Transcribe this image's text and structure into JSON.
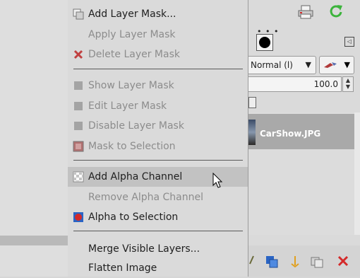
{
  "menu": {
    "items": [
      {
        "label": "Add Layer Mask...",
        "enabled": true,
        "icon": "add-mask-icon"
      },
      {
        "label": "Apply Layer Mask",
        "enabled": false,
        "icon": ""
      },
      {
        "label": "Delete Layer Mask",
        "enabled": false,
        "icon": "delete-icon"
      },
      {
        "label": "Show Layer Mask",
        "enabled": false,
        "icon": "checkbox-icon"
      },
      {
        "label": "Edit Layer Mask",
        "enabled": false,
        "icon": "checkbox-icon"
      },
      {
        "label": "Disable Layer Mask",
        "enabled": false,
        "icon": "checkbox-icon"
      },
      {
        "label": "Mask to Selection",
        "enabled": false,
        "icon": "mask-selection-icon"
      },
      {
        "label": "Add Alpha Channel",
        "enabled": true,
        "highlighted": true,
        "icon": "alpha-channel-icon"
      },
      {
        "label": "Remove Alpha Channel",
        "enabled": false,
        "icon": ""
      },
      {
        "label": "Alpha to Selection",
        "enabled": true,
        "icon": "alpha-selection-icon"
      },
      {
        "label": "Merge Visible Layers...",
        "enabled": true,
        "icon": ""
      },
      {
        "label": "Flatten Image",
        "enabled": true,
        "icon": ""
      }
    ]
  },
  "layers_panel": {
    "mode": "Normal (l)",
    "opacity": "100.0",
    "layer_name": "CarShow.JPG"
  },
  "colors": {
    "delete_red": "#d42a2a",
    "refresh_green": "#3cb43c",
    "selection_blue": "#2a64c4"
  }
}
